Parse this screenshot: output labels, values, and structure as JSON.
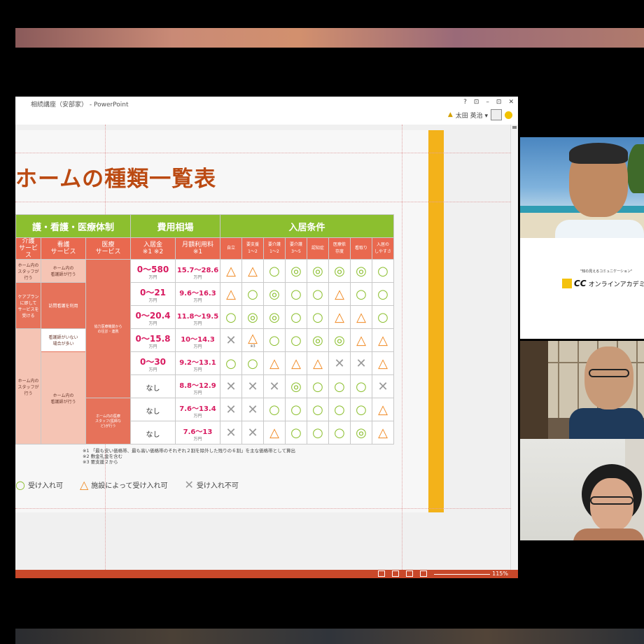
{
  "window": {
    "title": "相続講座（安部家） - PowerPoint",
    "controls": [
      "?",
      "⊡",
      "–",
      "⊡",
      "✕"
    ],
    "user_name": "太田 英治 ▾"
  },
  "slide": {
    "title": "ホームの種類一覧表",
    "header_groups": [
      "護・看護・医療体制",
      "費用相場",
      "入居条件"
    ],
    "subheaders": [
      "介護\nサービス",
      "看護\nサービス",
      "医療\nサービス",
      "入居金\n※1 ※2",
      "月額利用料\n※1",
      "自立",
      "要支援\n1～2",
      "要介護\n1～2",
      "要介護\n3～5",
      "認知症",
      "医療依\n存度",
      "看取り",
      "入居の\nしやすさ"
    ],
    "care_cells": [
      "ホーム内の\nスタッフが\n行う",
      "ケアプラン\nに即して\nサービスを\n受ける",
      "ホーム内の\nスタッフが\n行う"
    ],
    "nursing_cells": [
      "ホーム内の\n看護師が行う",
      "訪問看護を利用",
      "看護師がいない\n場合が多い",
      "ホーム内の\n看護師が行う"
    ],
    "medical_cells": [
      "協力医療機関から\nの往診・連携",
      "ホーム内の医療\nスタッフ(医師な\nど)が行う"
    ],
    "rows": [
      {
        "fee": "0～580",
        "fee_unit": "万円",
        "monthly": "15.7～28.6",
        "monthly_unit": "万円",
        "marks": [
          "tri",
          "tri",
          "circle",
          "dbl",
          "dbl",
          "dbl",
          "dbl",
          "circle"
        ]
      },
      {
        "fee": "0～21",
        "fee_unit": "万円",
        "monthly": "9.6～16.3",
        "monthly_unit": "万円",
        "marks": [
          "tri",
          "circle",
          "dbl",
          "circle",
          "circle",
          "tri",
          "circle",
          "circle"
        ]
      },
      {
        "fee": "0～20.4",
        "fee_unit": "万円",
        "monthly": "11.8～19.5",
        "monthly_unit": "万円",
        "marks": [
          "circle",
          "dbl",
          "dbl",
          "circle",
          "circle",
          "tri",
          "tri",
          "circle"
        ]
      },
      {
        "fee": "0～15.8",
        "fee_unit": "万円",
        "monthly": "10～14.3",
        "monthly_unit": "万円",
        "marks": [
          "x",
          "tri3",
          "circle",
          "circle",
          "dbl",
          "dbl",
          "tri",
          "tri"
        ]
      },
      {
        "fee": "0～30",
        "fee_unit": "万円",
        "monthly": "9.2～13.1",
        "monthly_unit": "万円",
        "marks": [
          "circle",
          "circle",
          "tri",
          "tri",
          "tri",
          "x",
          "x",
          "tri"
        ]
      },
      {
        "fee": "なし",
        "fee_unit": "",
        "monthly": "8.8～12.9",
        "monthly_unit": "万円",
        "marks": [
          "x",
          "x",
          "x",
          "dbl",
          "circle",
          "circle",
          "circle",
          "x"
        ]
      },
      {
        "fee": "なし",
        "fee_unit": "",
        "monthly": "7.6～13.4",
        "monthly_unit": "万円",
        "marks": [
          "x",
          "x",
          "circle",
          "circle",
          "circle",
          "circle",
          "circle",
          "tri"
        ]
      },
      {
        "fee": "なし",
        "fee_unit": "",
        "monthly": "7.6～13",
        "monthly_unit": "万円",
        "marks": [
          "x",
          "x",
          "tri",
          "circle",
          "circle",
          "circle",
          "dbl",
          "tri"
        ]
      }
    ],
    "note_label": "※3",
    "footnotes": [
      "※1 「最も安い価格帯、最も高い価格帯のそれぞれ２割を除外した残りの６割」を主な価格帯として算出",
      "※2 敷金礼金を含む",
      "※3 要支援２から"
    ],
    "legend": [
      {
        "symbol": "○",
        "label": "受け入れ可"
      },
      {
        "symbol": "△",
        "label": "施設によって受け入れ可"
      },
      {
        "symbol": "✕",
        "label": "受け入れ不可"
      }
    ]
  },
  "statusbar": {
    "zoom": "115%"
  },
  "video": {
    "tagline": "\"知の見えるコミュニケーション\"",
    "brand": "CC",
    "brand_sub": "オンラインアカデミ"
  },
  "colors": {
    "header_green": "#8cbf2f",
    "header_red": "#e9694f",
    "fee_pink": "#d81b60",
    "title_brown": "#bb4a12",
    "accent_orange": "#f3b21a",
    "statusbar": "#c8482a"
  }
}
